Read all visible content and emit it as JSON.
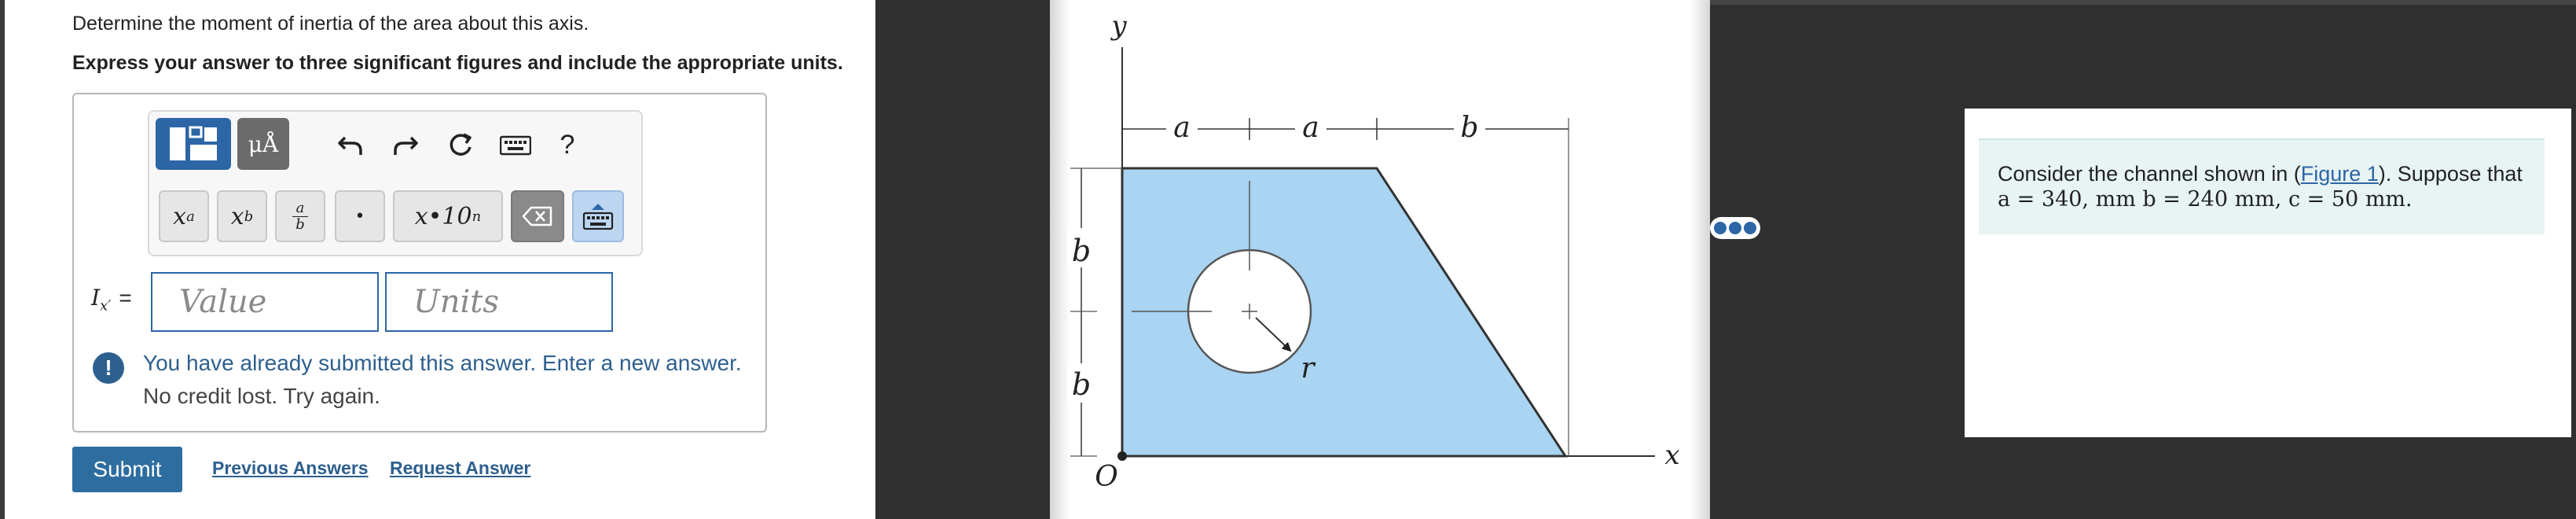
{
  "question": {
    "line1": "Determine the moment of inertia of the area about this axis.",
    "line2": "Express your answer to three significant figures and include the appropriate units."
  },
  "toolbar": {
    "mu_label": "μÅ",
    "help_label": "?",
    "exponent_base": "x",
    "exponent_sup": "a",
    "subscript_base": "x",
    "subscript_sub": "b",
    "frac_num": "a",
    "frac_den": "b",
    "dot_label": "•",
    "sci_label": "x•10",
    "sci_sup": "n"
  },
  "answer": {
    "label_var": "I",
    "label_sub": "x′",
    "label_eq": "=",
    "value_placeholder": "Value",
    "units_placeholder": "Units"
  },
  "feedback": {
    "line1": "You have already submitted this answer. Enter a new answer.",
    "line2": "No credit lost. Try again."
  },
  "actions": {
    "submit": "Submit",
    "previous": "Previous Answers",
    "request": "Request Answer"
  },
  "figure": {
    "y_label": "y",
    "x_label": "x",
    "origin_label": "O",
    "a_label": "a",
    "b_label": "b",
    "r_label": "r",
    "fill_color": "#a9d4f2"
  },
  "info": {
    "prefix": "Consider the channel shown in (",
    "link": "Figure 1",
    "suffix": "). Suppose that",
    "a_eq": "a = 340, mm",
    "b_eq": "b = 240 mm,",
    "c_eq": "c = 50 mm."
  },
  "colors": {
    "accent": "#2d66a6",
    "submit": "#2d6da0",
    "dark_panel": "#2f2f2f"
  }
}
